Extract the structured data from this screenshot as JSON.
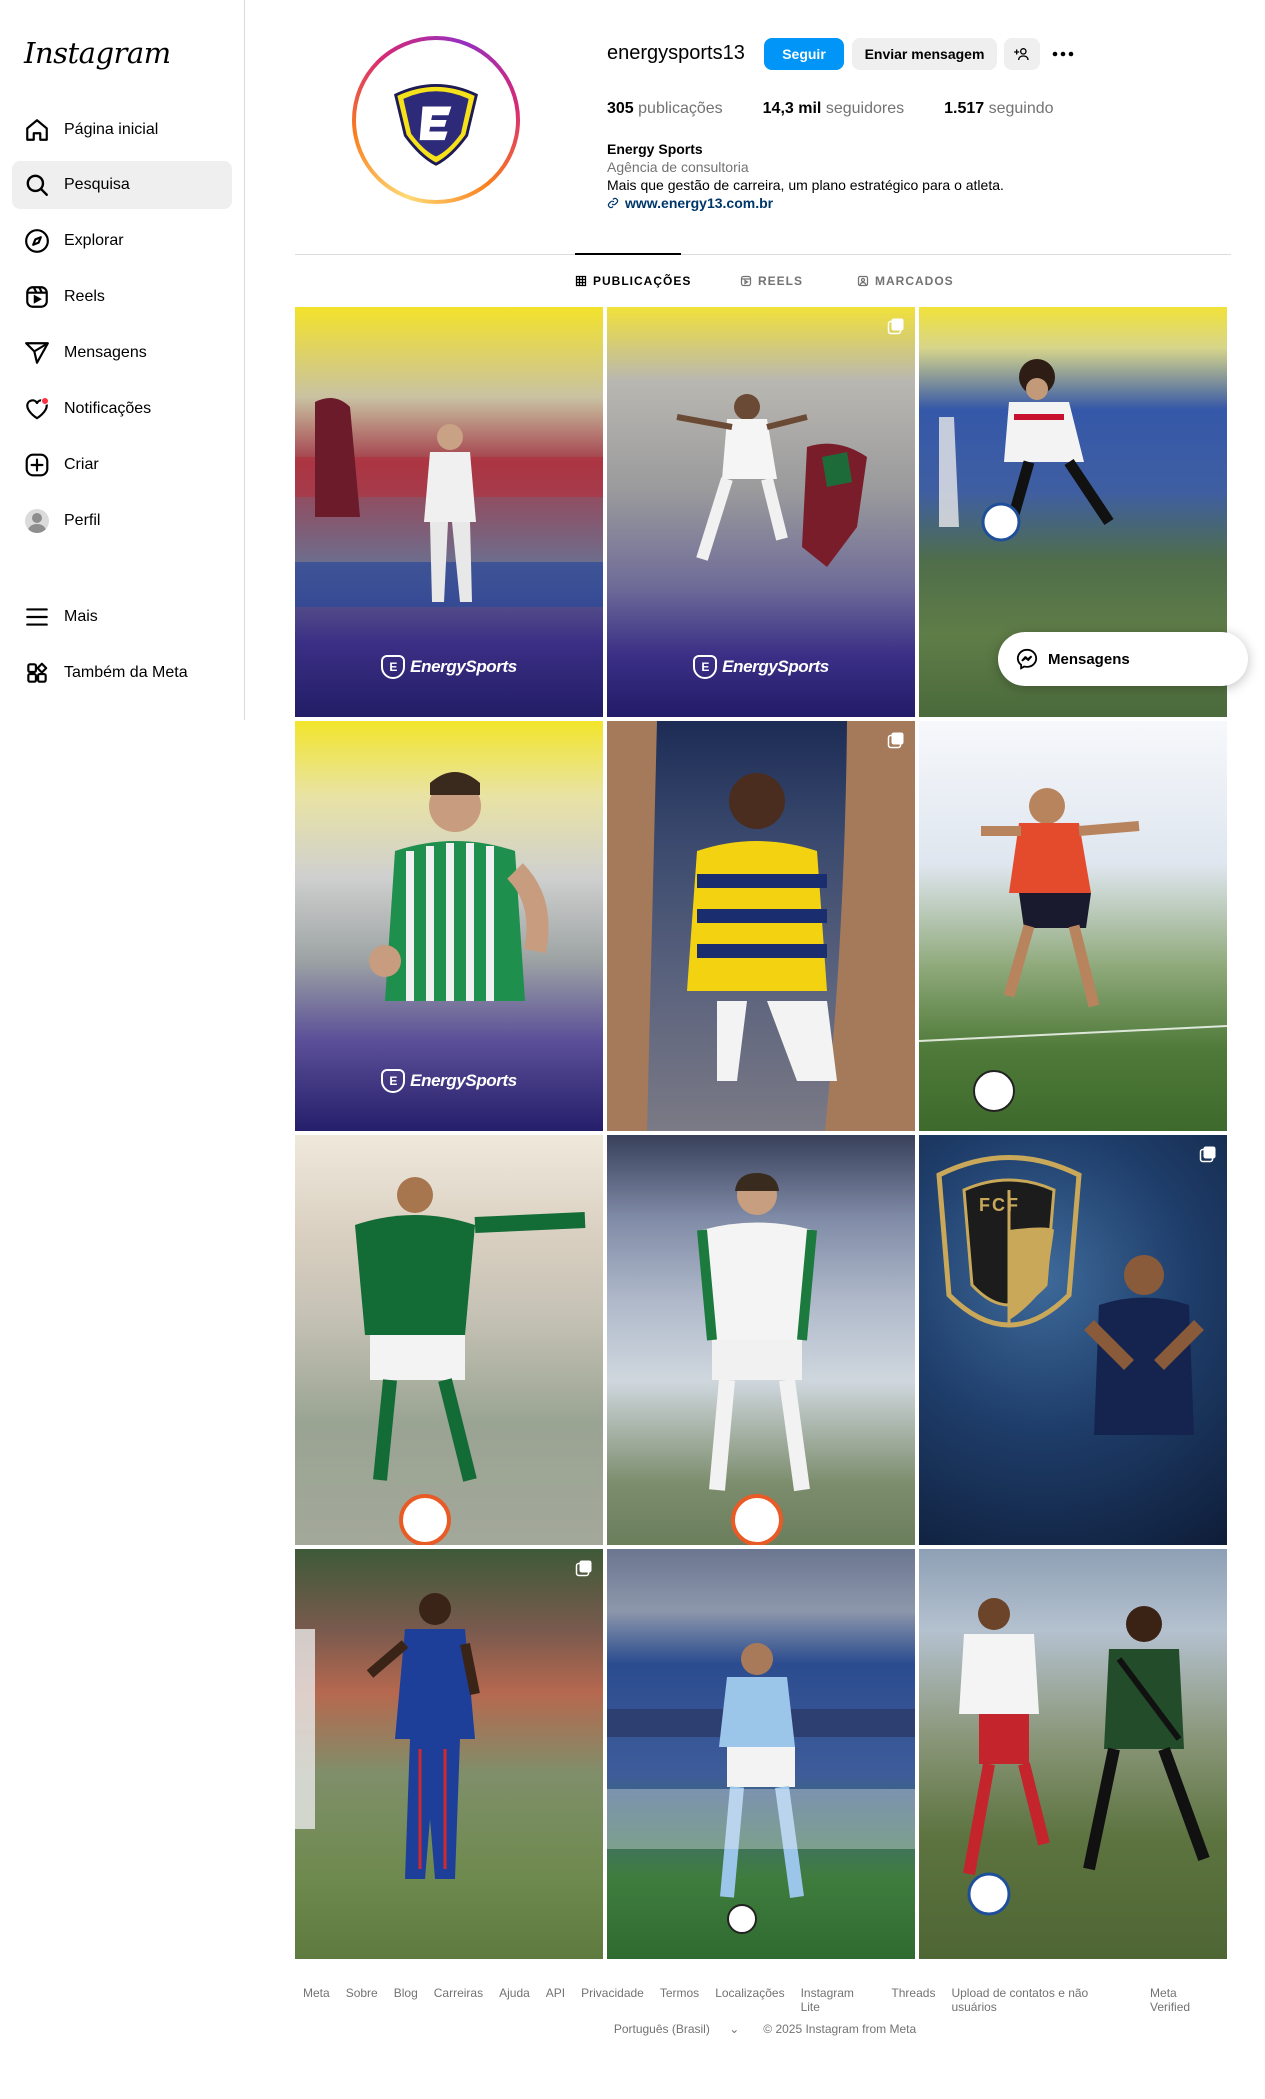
{
  "sidebar": {
    "logo": "Instagram",
    "items": [
      {
        "label": "Página inicial",
        "icon": "home-icon"
      },
      {
        "label": "Pesquisa",
        "icon": "search-icon"
      },
      {
        "label": "Explorar",
        "icon": "compass-icon"
      },
      {
        "label": "Reels",
        "icon": "reels-icon"
      },
      {
        "label": "Mensagens",
        "icon": "send-icon"
      },
      {
        "label": "Notificações",
        "icon": "heart-icon"
      },
      {
        "label": "Criar",
        "icon": "plus-square-icon"
      },
      {
        "label": "Perfil",
        "icon": "avatar"
      },
      {
        "label": "Mais",
        "icon": "menu-icon"
      },
      {
        "label": "Também da Meta",
        "icon": "meta-apps-icon"
      }
    ]
  },
  "profile": {
    "username": "energysports13",
    "follow_label": "Seguir",
    "message_label": "Enviar mensagem",
    "stats": {
      "posts_value": "305",
      "posts_label": "publicações",
      "followers_value": "14,3 mil",
      "followers_label": "seguidores",
      "following_value": "1.517",
      "following_label": "seguindo"
    },
    "bio": {
      "name": "Energy Sports",
      "category": "Agência de consultoria",
      "text": "Mais que gestão de carreira, um plano estratégico para o atleta.",
      "link": "www.energy13.com.br"
    }
  },
  "tabs": [
    {
      "label": "PUBLICAÇÕES",
      "icon": "grid-icon"
    },
    {
      "label": "REELS",
      "icon": "reels-icon"
    },
    {
      "label": "MARCADOS",
      "icon": "tagged-icon"
    }
  ],
  "watermark": "EnergySports",
  "fcf": "FCF",
  "messages_pill": "Mensagens",
  "footer": {
    "links": [
      "Meta",
      "Sobre",
      "Blog",
      "Carreiras",
      "Ajuda",
      "API",
      "Privacidade",
      "Termos",
      "Localizações",
      "Instagram Lite",
      "Threads",
      "Upload de contatos e não usuários",
      "Meta Verified"
    ],
    "language": "Português (Brasil)",
    "copyright": "© 2025 Instagram from Meta"
  },
  "colors": {
    "accent": "#0095f6",
    "brand_purple": "#2e2a7a",
    "brand_yellow": "#f5e21b"
  }
}
